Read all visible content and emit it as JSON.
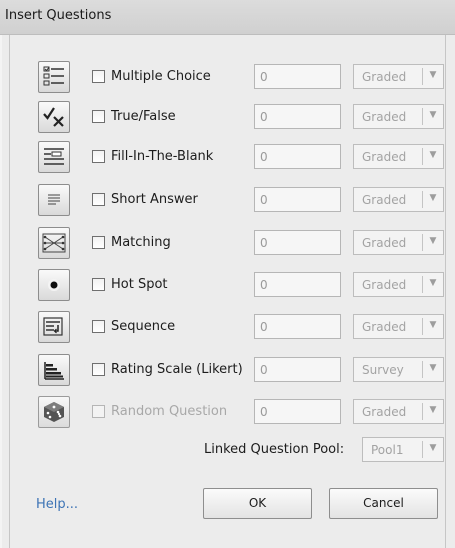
{
  "window": {
    "title": "Insert Questions"
  },
  "questions": [
    {
      "icon": "multiple-choice-icon",
      "label": "Multiple Choice",
      "count": "0",
      "mode": "Graded",
      "enabled": true
    },
    {
      "icon": "true-false-icon",
      "label": "True/False",
      "count": "0",
      "mode": "Graded",
      "enabled": true
    },
    {
      "icon": "fill-in-the-blank-icon",
      "label": "Fill-In-The-Blank",
      "count": "0",
      "mode": "Graded",
      "enabled": true
    },
    {
      "icon": "short-answer-icon",
      "label": "Short Answer",
      "count": "0",
      "mode": "Graded",
      "enabled": true
    },
    {
      "icon": "matching-icon",
      "label": "Matching",
      "count": "0",
      "mode": "Graded",
      "enabled": true
    },
    {
      "icon": "hot-spot-icon",
      "label": "Hot Spot",
      "count": "0",
      "mode": "Graded",
      "enabled": true
    },
    {
      "icon": "sequence-icon",
      "label": "Sequence",
      "count": "0",
      "mode": "Graded",
      "enabled": true
    },
    {
      "icon": "rating-scale-icon",
      "label": "Rating Scale (Likert)",
      "count": "0",
      "mode": "Survey",
      "enabled": true
    },
    {
      "icon": "random-question-icon",
      "label": "Random Question",
      "count": "0",
      "mode": "Graded",
      "enabled": false
    }
  ],
  "pool": {
    "label": "Linked Question Pool:",
    "value": "Pool1"
  },
  "footer": {
    "help": "Help...",
    "ok": "OK",
    "cancel": "Cancel"
  },
  "colors": {
    "link": "#3c73b5",
    "disabled_text": "#a8a8a8"
  }
}
